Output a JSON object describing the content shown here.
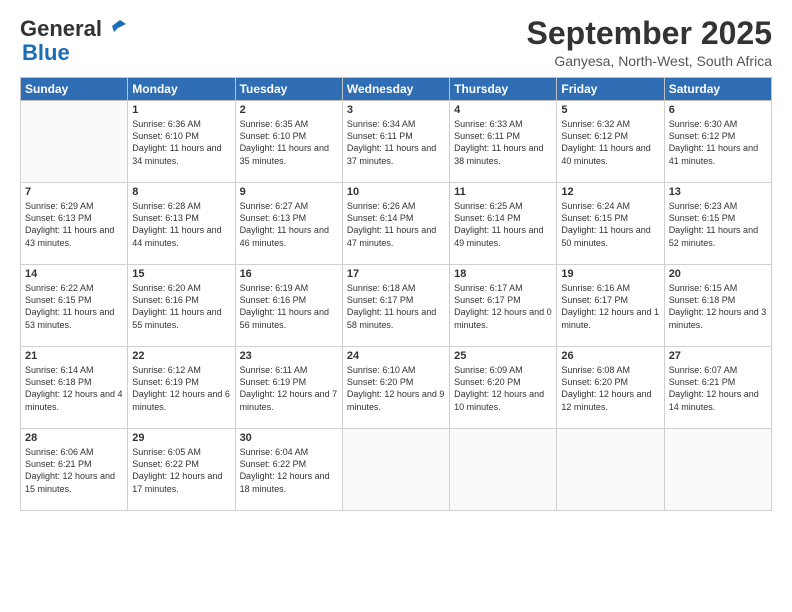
{
  "logo": {
    "line1": "General",
    "line2": "Blue"
  },
  "header": {
    "month": "September 2025",
    "location": "Ganyesa, North-West, South Africa"
  },
  "weekdays": [
    "Sunday",
    "Monday",
    "Tuesday",
    "Wednesday",
    "Thursday",
    "Friday",
    "Saturday"
  ],
  "weeks": [
    [
      {
        "day": "",
        "sunrise": "",
        "sunset": "",
        "daylight": ""
      },
      {
        "day": "1",
        "sunrise": "Sunrise: 6:36 AM",
        "sunset": "Sunset: 6:10 PM",
        "daylight": "Daylight: 11 hours and 34 minutes."
      },
      {
        "day": "2",
        "sunrise": "Sunrise: 6:35 AM",
        "sunset": "Sunset: 6:10 PM",
        "daylight": "Daylight: 11 hours and 35 minutes."
      },
      {
        "day": "3",
        "sunrise": "Sunrise: 6:34 AM",
        "sunset": "Sunset: 6:11 PM",
        "daylight": "Daylight: 11 hours and 37 minutes."
      },
      {
        "day": "4",
        "sunrise": "Sunrise: 6:33 AM",
        "sunset": "Sunset: 6:11 PM",
        "daylight": "Daylight: 11 hours and 38 minutes."
      },
      {
        "day": "5",
        "sunrise": "Sunrise: 6:32 AM",
        "sunset": "Sunset: 6:12 PM",
        "daylight": "Daylight: 11 hours and 40 minutes."
      },
      {
        "day": "6",
        "sunrise": "Sunrise: 6:30 AM",
        "sunset": "Sunset: 6:12 PM",
        "daylight": "Daylight: 11 hours and 41 minutes."
      }
    ],
    [
      {
        "day": "7",
        "sunrise": "Sunrise: 6:29 AM",
        "sunset": "Sunset: 6:13 PM",
        "daylight": "Daylight: 11 hours and 43 minutes."
      },
      {
        "day": "8",
        "sunrise": "Sunrise: 6:28 AM",
        "sunset": "Sunset: 6:13 PM",
        "daylight": "Daylight: 11 hours and 44 minutes."
      },
      {
        "day": "9",
        "sunrise": "Sunrise: 6:27 AM",
        "sunset": "Sunset: 6:13 PM",
        "daylight": "Daylight: 11 hours and 46 minutes."
      },
      {
        "day": "10",
        "sunrise": "Sunrise: 6:26 AM",
        "sunset": "Sunset: 6:14 PM",
        "daylight": "Daylight: 11 hours and 47 minutes."
      },
      {
        "day": "11",
        "sunrise": "Sunrise: 6:25 AM",
        "sunset": "Sunset: 6:14 PM",
        "daylight": "Daylight: 11 hours and 49 minutes."
      },
      {
        "day": "12",
        "sunrise": "Sunrise: 6:24 AM",
        "sunset": "Sunset: 6:15 PM",
        "daylight": "Daylight: 11 hours and 50 minutes."
      },
      {
        "day": "13",
        "sunrise": "Sunrise: 6:23 AM",
        "sunset": "Sunset: 6:15 PM",
        "daylight": "Daylight: 11 hours and 52 minutes."
      }
    ],
    [
      {
        "day": "14",
        "sunrise": "Sunrise: 6:22 AM",
        "sunset": "Sunset: 6:15 PM",
        "daylight": "Daylight: 11 hours and 53 minutes."
      },
      {
        "day": "15",
        "sunrise": "Sunrise: 6:20 AM",
        "sunset": "Sunset: 6:16 PM",
        "daylight": "Daylight: 11 hours and 55 minutes."
      },
      {
        "day": "16",
        "sunrise": "Sunrise: 6:19 AM",
        "sunset": "Sunset: 6:16 PM",
        "daylight": "Daylight: 11 hours and 56 minutes."
      },
      {
        "day": "17",
        "sunrise": "Sunrise: 6:18 AM",
        "sunset": "Sunset: 6:17 PM",
        "daylight": "Daylight: 11 hours and 58 minutes."
      },
      {
        "day": "18",
        "sunrise": "Sunrise: 6:17 AM",
        "sunset": "Sunset: 6:17 PM",
        "daylight": "Daylight: 12 hours and 0 minutes."
      },
      {
        "day": "19",
        "sunrise": "Sunrise: 6:16 AM",
        "sunset": "Sunset: 6:17 PM",
        "daylight": "Daylight: 12 hours and 1 minute."
      },
      {
        "day": "20",
        "sunrise": "Sunrise: 6:15 AM",
        "sunset": "Sunset: 6:18 PM",
        "daylight": "Daylight: 12 hours and 3 minutes."
      }
    ],
    [
      {
        "day": "21",
        "sunrise": "Sunrise: 6:14 AM",
        "sunset": "Sunset: 6:18 PM",
        "daylight": "Daylight: 12 hours and 4 minutes."
      },
      {
        "day": "22",
        "sunrise": "Sunrise: 6:12 AM",
        "sunset": "Sunset: 6:19 PM",
        "daylight": "Daylight: 12 hours and 6 minutes."
      },
      {
        "day": "23",
        "sunrise": "Sunrise: 6:11 AM",
        "sunset": "Sunset: 6:19 PM",
        "daylight": "Daylight: 12 hours and 7 minutes."
      },
      {
        "day": "24",
        "sunrise": "Sunrise: 6:10 AM",
        "sunset": "Sunset: 6:20 PM",
        "daylight": "Daylight: 12 hours and 9 minutes."
      },
      {
        "day": "25",
        "sunrise": "Sunrise: 6:09 AM",
        "sunset": "Sunset: 6:20 PM",
        "daylight": "Daylight: 12 hours and 10 minutes."
      },
      {
        "day": "26",
        "sunrise": "Sunrise: 6:08 AM",
        "sunset": "Sunset: 6:20 PM",
        "daylight": "Daylight: 12 hours and 12 minutes."
      },
      {
        "day": "27",
        "sunrise": "Sunrise: 6:07 AM",
        "sunset": "Sunset: 6:21 PM",
        "daylight": "Daylight: 12 hours and 14 minutes."
      }
    ],
    [
      {
        "day": "28",
        "sunrise": "Sunrise: 6:06 AM",
        "sunset": "Sunset: 6:21 PM",
        "daylight": "Daylight: 12 hours and 15 minutes."
      },
      {
        "day": "29",
        "sunrise": "Sunrise: 6:05 AM",
        "sunset": "Sunset: 6:22 PM",
        "daylight": "Daylight: 12 hours and 17 minutes."
      },
      {
        "day": "30",
        "sunrise": "Sunrise: 6:04 AM",
        "sunset": "Sunset: 6:22 PM",
        "daylight": "Daylight: 12 hours and 18 minutes."
      },
      {
        "day": "",
        "sunrise": "",
        "sunset": "",
        "daylight": ""
      },
      {
        "day": "",
        "sunrise": "",
        "sunset": "",
        "daylight": ""
      },
      {
        "day": "",
        "sunrise": "",
        "sunset": "",
        "daylight": ""
      },
      {
        "day": "",
        "sunrise": "",
        "sunset": "",
        "daylight": ""
      }
    ]
  ]
}
